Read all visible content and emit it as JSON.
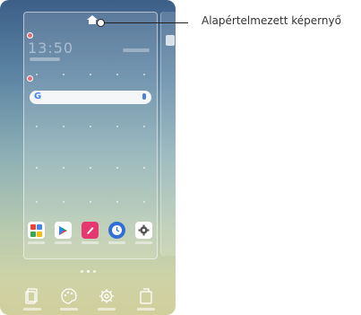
{
  "callout": {
    "label": "Alapértelmezett képernyő"
  },
  "screen": {
    "clock_text": "13:50",
    "pages_count": 3,
    "active_page": 1
  },
  "search_bar": {
    "logo": "G"
  },
  "apps": [
    {
      "name": "folder-app-icon",
      "color": "#ffffff"
    },
    {
      "name": "play-store-icon",
      "color": "#ffffff"
    },
    {
      "name": "notes-pen-icon",
      "color": "#e6386f"
    },
    {
      "name": "clock-app-icon",
      "color": "#2f6fd6"
    },
    {
      "name": "settings-gear-icon",
      "color": "#ffffff"
    }
  ],
  "bottom_bar": [
    {
      "name": "wallpapers-icon"
    },
    {
      "name": "themes-palette-icon"
    },
    {
      "name": "home-settings-gear-icon"
    },
    {
      "name": "widgets-icon"
    }
  ]
}
